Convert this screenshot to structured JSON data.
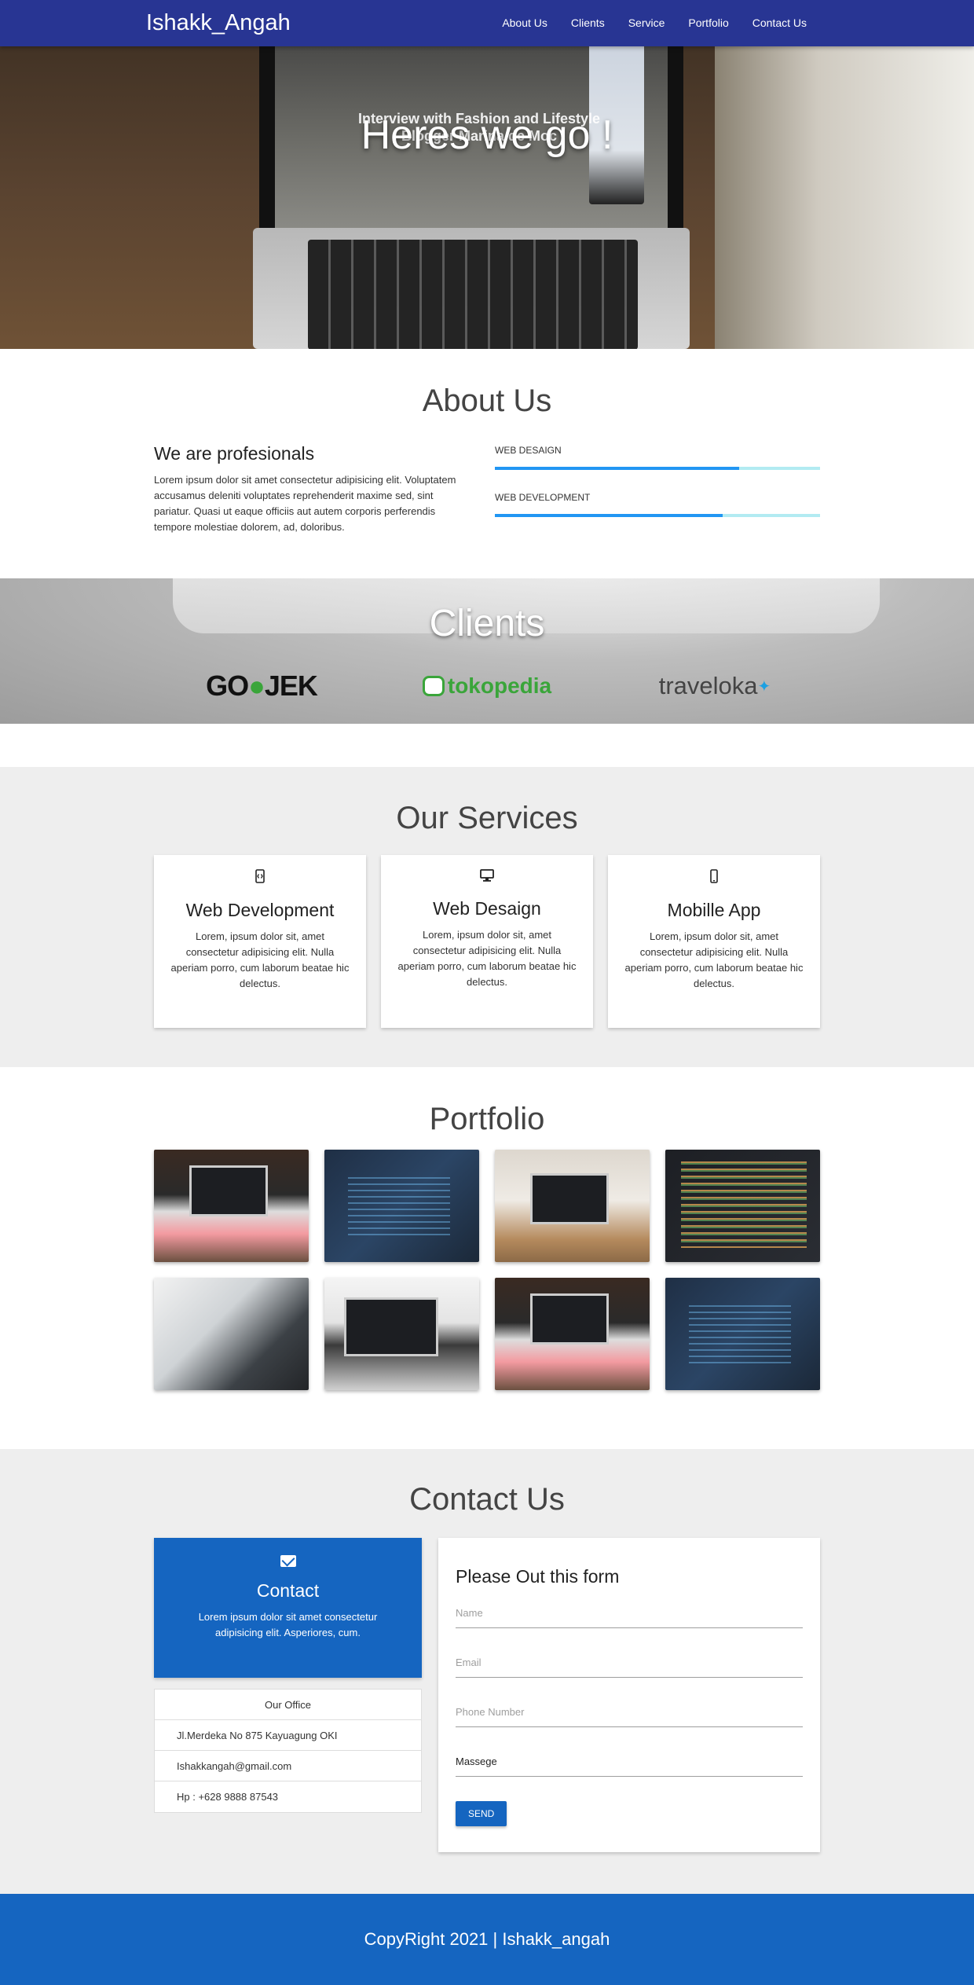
{
  "navbar": {
    "brand": "Ishakk_Angah",
    "links": [
      "About Us",
      "Clients",
      "Service",
      "Portfolio",
      "Contact Us"
    ]
  },
  "hero": {
    "title": "Heres we go !",
    "screen_text": "Interview with Fashion and Lifestyle Blogger Marina de Moc"
  },
  "about": {
    "title": "About Us",
    "heading": "We are profesionals",
    "paragraph": "Lorem ipsum dolor sit amet consectetur adipisicing elit. Voluptatem accusamus deleniti voluptates reprehenderit maxime sed, sint pariatur. Quasi ut eaque officiis aut autem corporis perferendis tempore molestiae dolorem, ad, doloribus.",
    "skills": [
      {
        "label": "WEB DESAIGN",
        "percent": 75
      },
      {
        "label": "WEB DEVELOPMENT",
        "percent": 70
      }
    ]
  },
  "clients": {
    "title": "Clients",
    "logos": [
      "GO-JEK",
      "tokopedia",
      "traveloka"
    ],
    "gojek_part1": "GO",
    "gojek_part2": "JEK",
    "tokopedia_text": "tokopedia",
    "traveloka_text": "traveloka"
  },
  "services": {
    "title": "Our Services",
    "items": [
      {
        "icon": "mobile-code-icon",
        "title": "Web Development",
        "text": "Lorem, ipsum dolor sit, amet consectetur adipisicing elit. Nulla aperiam porro, cum laborum beatae hic delectus."
      },
      {
        "icon": "desktop-icon",
        "title": "Web Desaign",
        "text": "Lorem, ipsum dolor sit, amet consectetur adipisicing elit. Nulla aperiam porro, cum laborum beatae hic delectus."
      },
      {
        "icon": "smartphone-icon",
        "title": "Mobille App",
        "text": "Lorem, ipsum dolor sit, amet consectetur adipisicing elit. Nulla aperiam porro, cum laborum beatae hic delectus."
      }
    ]
  },
  "portfolio": {
    "title": "Portfolio"
  },
  "contact": {
    "title": "Contact Us",
    "card_title": "Contact",
    "card_text": "Lorem ipsum dolor sit amet consectetur adipisicing elit. Asperiores, cum.",
    "office_title": "Our Office",
    "address": "Jl.Merdeka No 875 Kayuagung OKI",
    "email": "Ishakkangah@gmail.com",
    "phone": "Hp : +628 9888 87543",
    "form_title": "Please Out this form",
    "name_placeholder": "Name",
    "email_placeholder": "Email",
    "phone_placeholder": "Phone Number",
    "message_placeholder": "Massege",
    "send_label": "SEND"
  },
  "footer": {
    "text": "CopyRight 2021 | Ishakk_angah"
  },
  "colors": {
    "navbar": "#283593",
    "primary": "#1565c0",
    "progress": "#2196f3",
    "progress_track": "#b2ebf2"
  }
}
